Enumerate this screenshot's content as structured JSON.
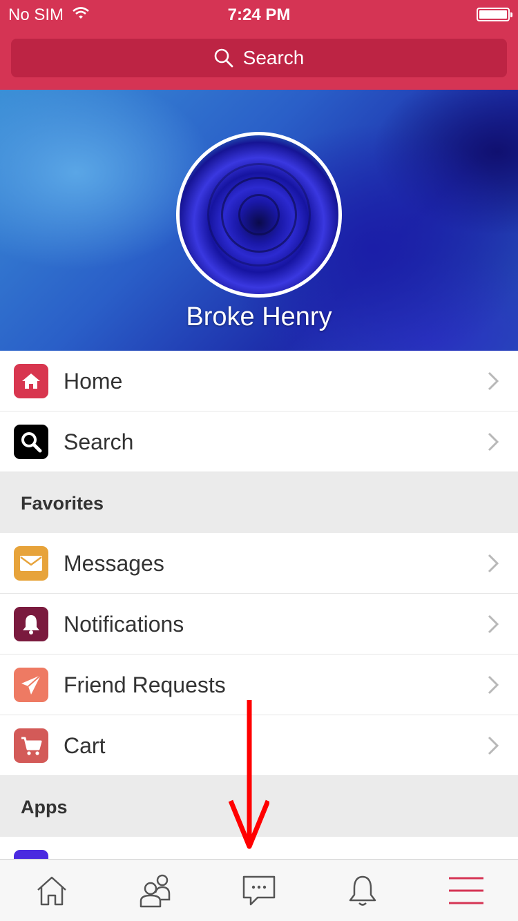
{
  "status_bar": {
    "carrier": "No SIM",
    "time": "7:24 PM"
  },
  "search": {
    "label": "Search"
  },
  "profile": {
    "name": "Broke Henry"
  },
  "menu": {
    "home": {
      "label": "Home",
      "icon": "home-icon",
      "color": "#d8364f"
    },
    "search": {
      "label": "Search",
      "icon": "magnifier-icon",
      "color": "#000000"
    },
    "favorites_header": "Favorites",
    "messages": {
      "label": "Messages",
      "icon": "envelope-icon",
      "color": "#e7a33a"
    },
    "notifications": {
      "label": "Notifications",
      "icon": "bell-icon",
      "color": "#7a1a3e"
    },
    "friend_requests": {
      "label": "Friend Requests",
      "icon": "paper-plane-icon",
      "color": "#ee7a63"
    },
    "cart": {
      "label": "Cart",
      "icon": "cart-icon",
      "color": "#d35a58"
    },
    "apps_header": "Apps"
  },
  "tabs": [
    "home-icon",
    "friends-icon",
    "chat-icon",
    "bell-icon",
    "menu-icon"
  ],
  "colors": {
    "brand": "#d53454",
    "search_bg": "#bd2444",
    "annotation_arrow": "#ff0000"
  }
}
